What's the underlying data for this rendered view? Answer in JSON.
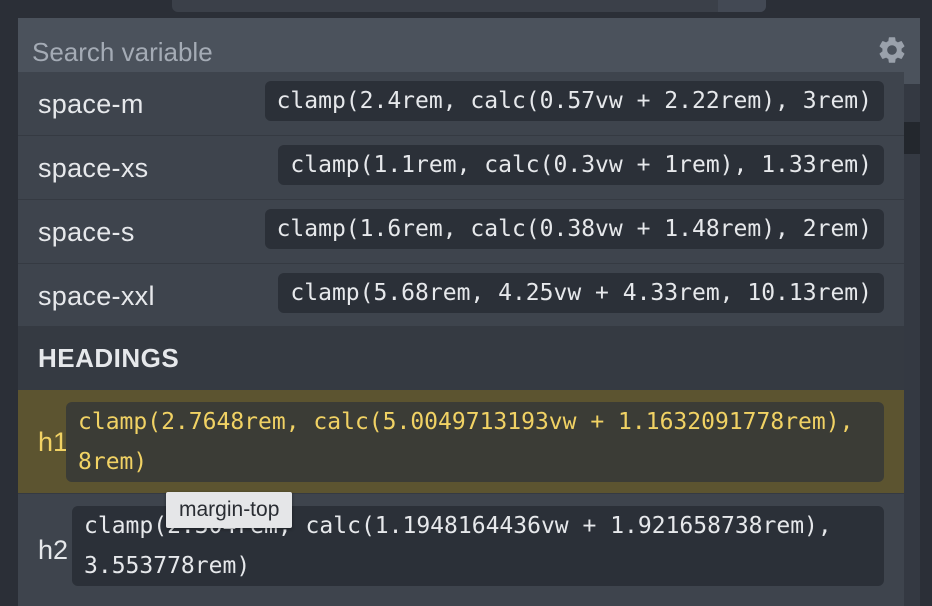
{
  "search": {
    "placeholder": "Search variable",
    "value": ""
  },
  "spacing_rows": [
    {
      "name": "space-m",
      "value": "clamp(2.4rem, calc(0.57vw + 2.22rem), 3rem)"
    },
    {
      "name": "space-xs",
      "value": "clamp(1.1rem, calc(0.3vw + 1rem), 1.33rem)"
    },
    {
      "name": "space-s",
      "value": "clamp(1.6rem, calc(0.38vw + 1.48rem), 2rem)"
    },
    {
      "name": "space-xxl",
      "value": "clamp(5.68rem, 4.25vw + 4.33rem, 10.13rem)"
    }
  ],
  "headings_section": {
    "label": "HEADINGS"
  },
  "heading_rows": [
    {
      "name": "h1",
      "value": "clamp(2.7648rem, calc(5.0049713193vw + 1.1632091778rem), 8rem)",
      "highlighted": true
    },
    {
      "name": "h2",
      "value": "clamp(2.304rem, calc(1.1948164436vw + 1.921658738rem), 3.553778rem)",
      "highlighted": false
    }
  ],
  "tooltip": {
    "text": "margin-top"
  },
  "colors": {
    "panel_bg": "#3e444d",
    "search_bg": "#4b525c",
    "chip_bg": "#2b3038",
    "highlight_bg": "#5c5430",
    "highlight_text": "#f1d264",
    "text": "#e6e8eb"
  },
  "icons": {
    "settings": "gear-icon"
  }
}
